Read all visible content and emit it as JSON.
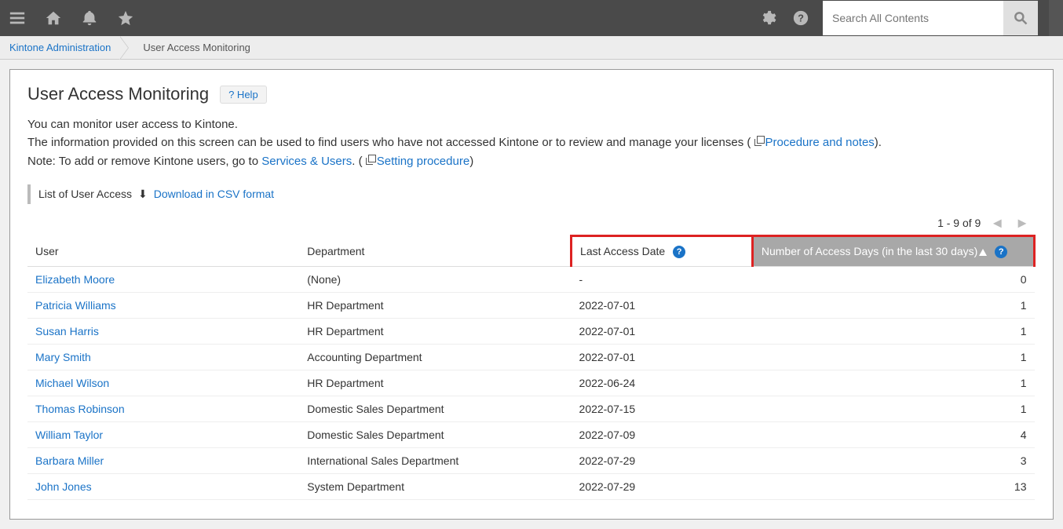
{
  "search": {
    "placeholder": "Search All Contents"
  },
  "breadcrumb": {
    "root": "Kintone Administration",
    "current": "User Access Monitoring"
  },
  "page": {
    "title": "User Access Monitoring",
    "help_label": "? Help",
    "desc_line1": "You can monitor user access to Kintone.",
    "desc_line2a": "The information provided on this screen can be used to find users who have not accessed Kintone or to review and manage your licenses ( ",
    "desc_link1": "Procedure and notes",
    "desc_line2b": ").",
    "desc_line3a": "Note: To add or remove Kintone users, go to ",
    "desc_link2": "Services & Users",
    "desc_line3b": ". ( ",
    "desc_link3": "Setting procedure",
    "desc_line3c": ")"
  },
  "list": {
    "title": "List of User Access",
    "download": "Download in CSV format",
    "pager": "1 - 9 of 9"
  },
  "table": {
    "headers": {
      "user": "User",
      "dept": "Department",
      "date": "Last Access Date",
      "days": "Number of Access Days (in the last 30 days)"
    },
    "rows": [
      {
        "user": "Elizabeth Moore",
        "dept": "(None)",
        "date": "-",
        "days": "0"
      },
      {
        "user": "Patricia Williams",
        "dept": "HR Department",
        "date": "2022-07-01",
        "days": "1"
      },
      {
        "user": "Susan Harris",
        "dept": "HR Department",
        "date": "2022-07-01",
        "days": "1"
      },
      {
        "user": "Mary Smith",
        "dept": "Accounting Department",
        "date": "2022-07-01",
        "days": "1"
      },
      {
        "user": "Michael Wilson",
        "dept": "HR Department",
        "date": "2022-06-24",
        "days": "1"
      },
      {
        "user": "Thomas Robinson",
        "dept": "Domestic Sales Department",
        "date": "2022-07-15",
        "days": "1"
      },
      {
        "user": "William Taylor",
        "dept": "Domestic Sales Department",
        "date": "2022-07-09",
        "days": "4"
      },
      {
        "user": "Barbara Miller",
        "dept": "International Sales Department",
        "date": "2022-07-29",
        "days": "3"
      },
      {
        "user": "John Jones",
        "dept": "System Department",
        "date": "2022-07-29",
        "days": "13"
      }
    ]
  }
}
